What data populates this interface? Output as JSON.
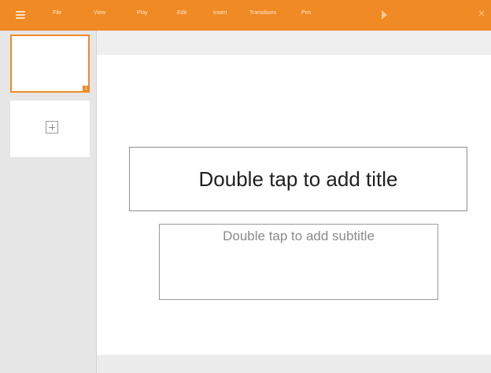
{
  "toolbar": {
    "menu_items": [
      "File",
      "View",
      "Play",
      "Edit",
      "Insert",
      "Transitions",
      "Pen"
    ]
  },
  "sidebar": {
    "slides": [
      {
        "number": "1"
      }
    ]
  },
  "slide": {
    "title_placeholder": "Double tap to add title",
    "subtitle_placeholder": "Double tap to add subtitle"
  },
  "colors": {
    "accent": "#f08a24"
  },
  "icons": [
    "hamburger-menu-icon",
    "play-icon",
    "close-icon",
    "add-slide-icon"
  ]
}
